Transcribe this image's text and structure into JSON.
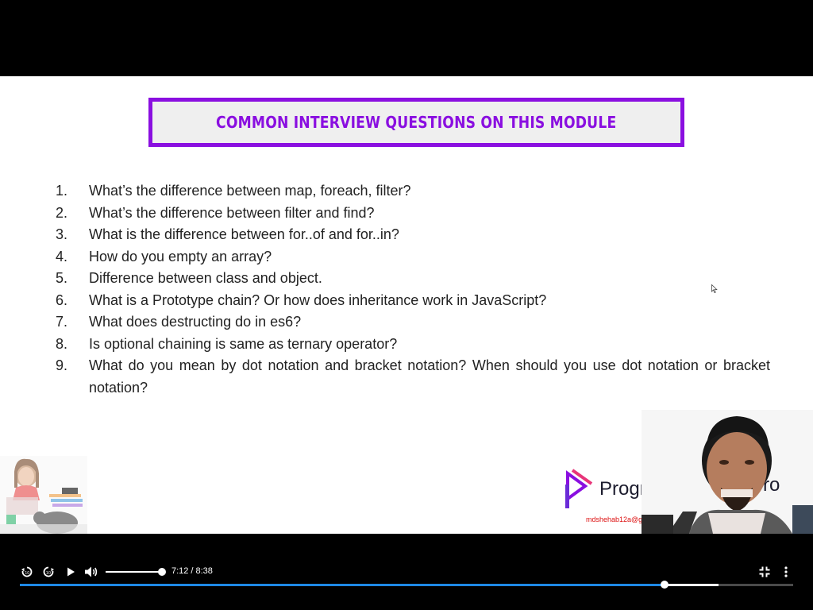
{
  "slide": {
    "title": "Common Interview Questions on this module",
    "questions": [
      {
        "num": "1.",
        "text": "What’s the difference between map, foreach, filter?"
      },
      {
        "num": "2.",
        "text": "What’s the difference between filter and find?"
      },
      {
        "num": "3.",
        "text": "What is the difference between for..of and for..in?"
      },
      {
        "num": "4.",
        "text": "How do you empty an array?"
      },
      {
        "num": "5.",
        "text": "Difference between class and object."
      },
      {
        "num": "6.",
        "text": "What is a Prototype chain? Or how does inheritance work in JavaScript?"
      },
      {
        "num": "7.",
        "text": "What does destructing do in es6?"
      },
      {
        "num": "8.",
        "text": "Is optional chaining is same as ternary operator?"
      },
      {
        "num": "9.",
        "text": "What do you mean by dot notation and bracket notation? When should you use dot notation or bracket notation?"
      }
    ],
    "brand_name": "Programmi",
    "brand_suffix": "ro",
    "email": "mdshehab12a@gmail.com"
  },
  "player": {
    "current_time": "7:12",
    "duration": "8:38",
    "separator": "/",
    "volume": 1.0,
    "played_fraction": 0.834,
    "buffered_fraction": 0.904
  },
  "colors": {
    "accent_purple": "#8a0fe0",
    "progress_blue": "#1e88e5",
    "email_red": "#dd1111"
  },
  "icons": {
    "rewind": "rewind-10-icon",
    "forward": "forward-10-icon",
    "play": "play-icon",
    "volume": "volume-icon",
    "exit_fullscreen": "exit-fullscreen-icon",
    "more": "more-vertical-icon"
  }
}
